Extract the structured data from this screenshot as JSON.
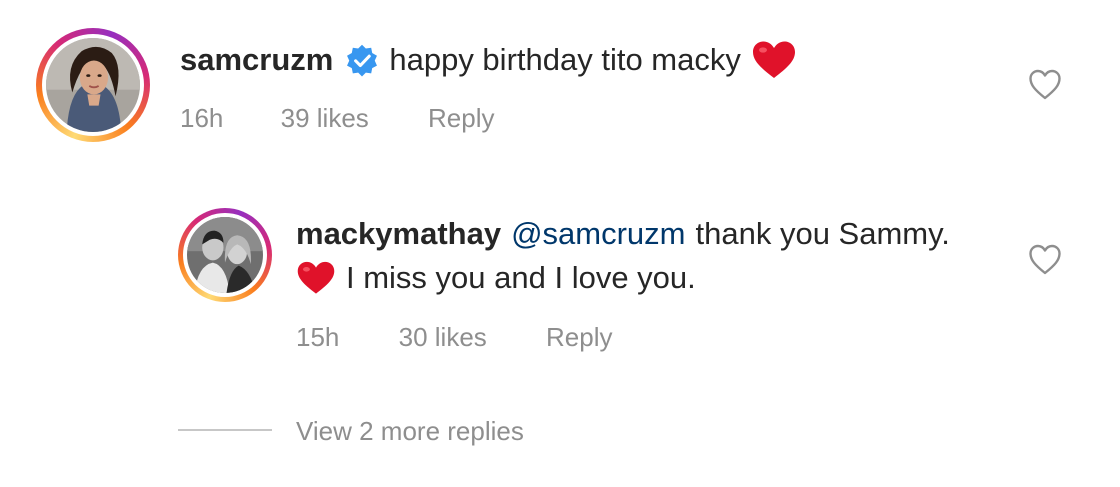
{
  "comment": {
    "username": "samcruzm",
    "text": "happy birthday tito macky",
    "time": "16h",
    "likes": "39 likes",
    "reply_label": "Reply",
    "verified_icon": "verified-badge-icon",
    "emoji": "red-heart-emoji"
  },
  "reply": {
    "username": "mackymathay",
    "mention": "@samcruzm",
    "text_line1": "thank you Sammy.",
    "text_line2": "I miss you and I love you.",
    "time": "15h",
    "likes": "30 likes",
    "reply_label": "Reply",
    "emoji": "red-heart-emoji"
  },
  "view_more": {
    "label": "View 2 more replies"
  },
  "colors": {
    "text": "#262626",
    "secondary": "#8e8e8e",
    "mention": "#00376b",
    "verified": "#3897f0",
    "heart_emoji": "#e0122a"
  }
}
